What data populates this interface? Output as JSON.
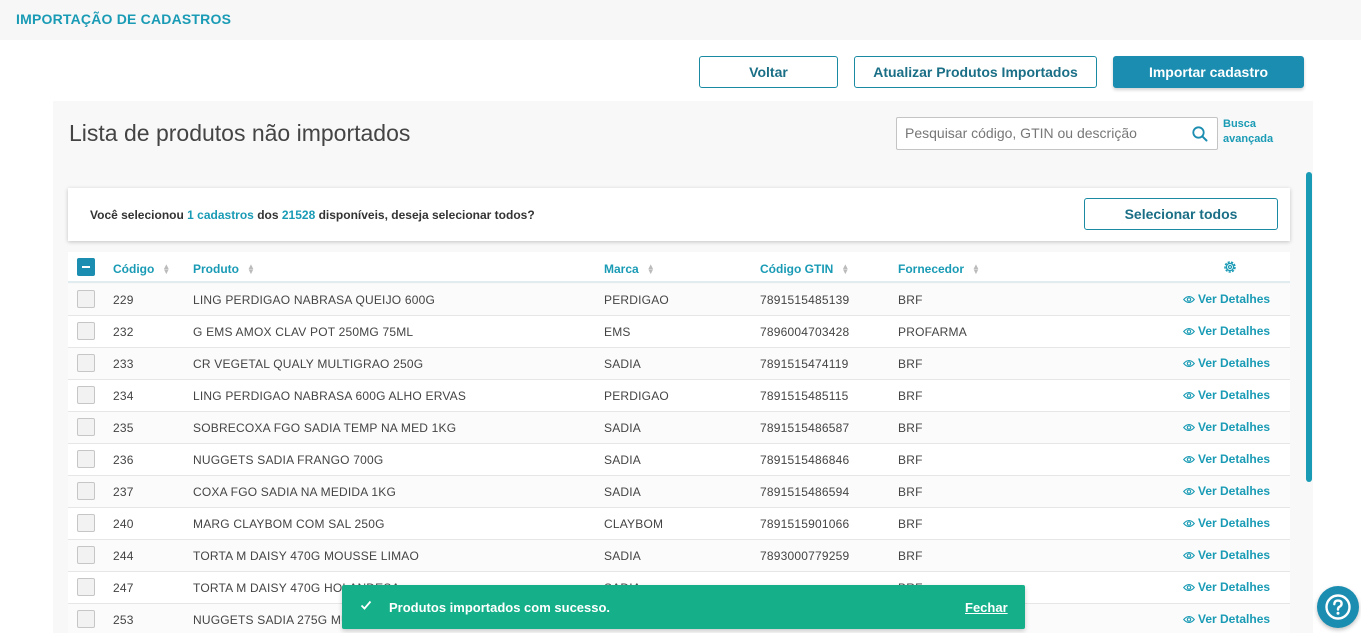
{
  "header": {
    "title": "IMPORTAÇÃO DE CADASTROS"
  },
  "actions": {
    "voltar": "Voltar",
    "atualizar": "Atualizar Produtos Importados",
    "importar": "Importar cadastro"
  },
  "panel": {
    "title": "Lista de produtos não importados",
    "search_placeholder": "Pesquisar código, GTIN ou descrição",
    "busca_line1": "Busca",
    "busca_line2": "avançada"
  },
  "selection": {
    "prefix": "Você selecionou ",
    "count": "1 cadastros",
    "middle": " dos ",
    "total": "21528",
    "suffix": " disponíveis, deseja selecionar todos?",
    "select_all": "Selecionar todos"
  },
  "table": {
    "columns": [
      "Código",
      "Produto",
      "Marca",
      "Código GTIN",
      "Fornecedor"
    ],
    "details_label": "Ver Detalhes",
    "rows": [
      {
        "codigo": "229",
        "produto": "LING PERDIGAO NABRASA QUEIJO 600G",
        "marca": "PERDIGAO",
        "gtin": "7891515485139",
        "fornecedor": "BRF"
      },
      {
        "codigo": "232",
        "produto": "G EMS AMOX CLAV POT 250MG 75ML",
        "marca": "EMS",
        "gtin": "7896004703428",
        "fornecedor": "PROFARMA"
      },
      {
        "codigo": "233",
        "produto": "CR VEGETAL QUALY MULTIGRAO 250G",
        "marca": "SADIA",
        "gtin": "7891515474119",
        "fornecedor": "BRF"
      },
      {
        "codigo": "234",
        "produto": "LING PERDIGAO NABRASA 600G ALHO ERVAS",
        "marca": "PERDIGAO",
        "gtin": "7891515485115",
        "fornecedor": "BRF"
      },
      {
        "codigo": "235",
        "produto": "SOBRECOXA FGO SADIA TEMP NA MED 1KG",
        "marca": "SADIA",
        "gtin": "7891515486587",
        "fornecedor": "BRF"
      },
      {
        "codigo": "236",
        "produto": "NUGGETS SADIA FRANGO 700G",
        "marca": "SADIA",
        "gtin": "7891515486846",
        "fornecedor": "BRF"
      },
      {
        "codigo": "237",
        "produto": "COXA FGO SADIA NA MEDIDA 1KG",
        "marca": "SADIA",
        "gtin": "7891515486594",
        "fornecedor": "BRF"
      },
      {
        "codigo": "240",
        "produto": "MARG CLAYBOM COM SAL 250G",
        "marca": "CLAYBOM",
        "gtin": "7891515901066",
        "fornecedor": "BRF"
      },
      {
        "codigo": "244",
        "produto": "TORTA M DAISY 470G MOUSSE LIMAO",
        "marca": "SADIA",
        "gtin": "7893000779259",
        "fornecedor": "BRF"
      },
      {
        "codigo": "247",
        "produto": "TORTA M DAISY 470G HOLANDESA",
        "marca": "SADIA",
        "gtin": "",
        "fornecedor": "BRF"
      },
      {
        "codigo": "253",
        "produto": "NUGGETS SADIA 275G MU",
        "marca": "",
        "gtin": "",
        "fornecedor": ""
      }
    ]
  },
  "toast": {
    "message": "Produtos importados com sucesso.",
    "close": "Fechar"
  },
  "colors": {
    "accent": "#1a9bb5",
    "primary": "#1a8db0",
    "success": "#15b08a"
  }
}
